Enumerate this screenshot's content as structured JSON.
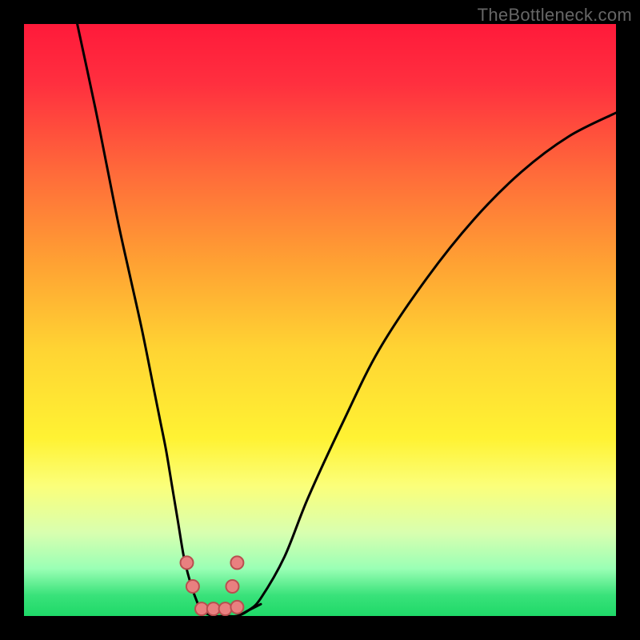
{
  "watermark": "TheBottleneck.com",
  "chart_data": {
    "type": "line",
    "title": "",
    "xlabel": "",
    "ylabel": "",
    "xlim": [
      0,
      100
    ],
    "ylim": [
      0,
      100
    ],
    "note": "Two V-shaped bottleneck curves over a vertical red→green gradient; y represents bottleneck percentage (high = red/bad, low = green/good). Values estimated from pixel positions.",
    "series": [
      {
        "name": "curve-left",
        "x": [
          9,
          12,
          14,
          16,
          18,
          20,
          22,
          23,
          24,
          25,
          26,
          27,
          28,
          29,
          30,
          32,
          34,
          36,
          38,
          40
        ],
        "values": [
          100,
          86,
          76,
          66,
          57,
          48,
          38,
          33,
          28,
          22,
          16,
          10,
          6,
          3,
          1,
          0,
          0,
          0,
          1,
          2
        ]
      },
      {
        "name": "curve-right",
        "x": [
          32,
          34,
          36,
          38,
          40,
          44,
          48,
          54,
          60,
          68,
          76,
          84,
          92,
          100
        ],
        "values": [
          2,
          0,
          0,
          1,
          3,
          10,
          20,
          33,
          45,
          57,
          67,
          75,
          81,
          85
        ]
      }
    ],
    "markers": [
      {
        "name": "marker-left-upper",
        "x": 27.5,
        "y": 9
      },
      {
        "name": "marker-left-lower",
        "x": 28.5,
        "y": 5
      },
      {
        "name": "marker-right-upper",
        "x": 36,
        "y": 9
      },
      {
        "name": "marker-right-lower",
        "x": 35.2,
        "y": 5
      },
      {
        "name": "marker-floor-a",
        "x": 30,
        "y": 1.2
      },
      {
        "name": "marker-floor-b",
        "x": 32,
        "y": 1.2
      },
      {
        "name": "marker-floor-c",
        "x": 34,
        "y": 1.2
      },
      {
        "name": "marker-floor-d",
        "x": 36,
        "y": 1.5
      }
    ],
    "gradient_stops": [
      {
        "pos": 0.0,
        "color": "#ff1a3a"
      },
      {
        "pos": 0.1,
        "color": "#ff2f3f"
      },
      {
        "pos": 0.25,
        "color": "#ff6a3a"
      },
      {
        "pos": 0.4,
        "color": "#ffa033"
      },
      {
        "pos": 0.55,
        "color": "#ffd433"
      },
      {
        "pos": 0.7,
        "color": "#fff233"
      },
      {
        "pos": 0.78,
        "color": "#fbff7a"
      },
      {
        "pos": 0.86,
        "color": "#d8ffb0"
      },
      {
        "pos": 0.92,
        "color": "#9affb5"
      },
      {
        "pos": 0.965,
        "color": "#39e27a"
      },
      {
        "pos": 1.0,
        "color": "#1fd968"
      }
    ],
    "marker_style": {
      "fill": "#e98080",
      "stroke": "#b84f4f",
      "r": 8
    }
  }
}
